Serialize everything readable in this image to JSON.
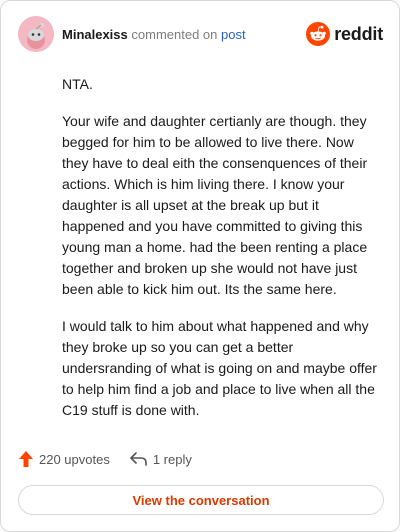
{
  "comment": {
    "username": "Minalexiss",
    "action_text": "commented on",
    "post_link": "post",
    "brand": "reddit",
    "paragraphs": [
      "NTA.",
      "Your wife and daughter certianly are though. they begged for him to be allowed to live there. Now they have to deal eith the consenquences of their actions. Which is him living there. I know your daughter is all upset at the break up but it happened and you have committed to giving this young man a home. had the been renting a place together and broken up she would not have just been able to kick him out. Its the same here.",
      "I would talk to him about what happened and why they broke up so you can get a better undersranding of what is going on and maybe offer to help him find a job and place to live when all the C19 stuff is done with."
    ]
  },
  "actions": {
    "upvotes_label": "220 upvotes",
    "reply_label": "1 reply"
  },
  "cta": {
    "label": "View the conversation"
  },
  "colors": {
    "accent": "#d93a00",
    "upvote": "#ff4500",
    "link": "#2a61c9",
    "avatar_bg": "#f4b7c4"
  },
  "icons": {
    "avatar": "snoo-avatar",
    "brand": "reddit-logo-icon",
    "upvote": "upvote-arrow-icon",
    "reply": "reply-arrow-icon"
  }
}
